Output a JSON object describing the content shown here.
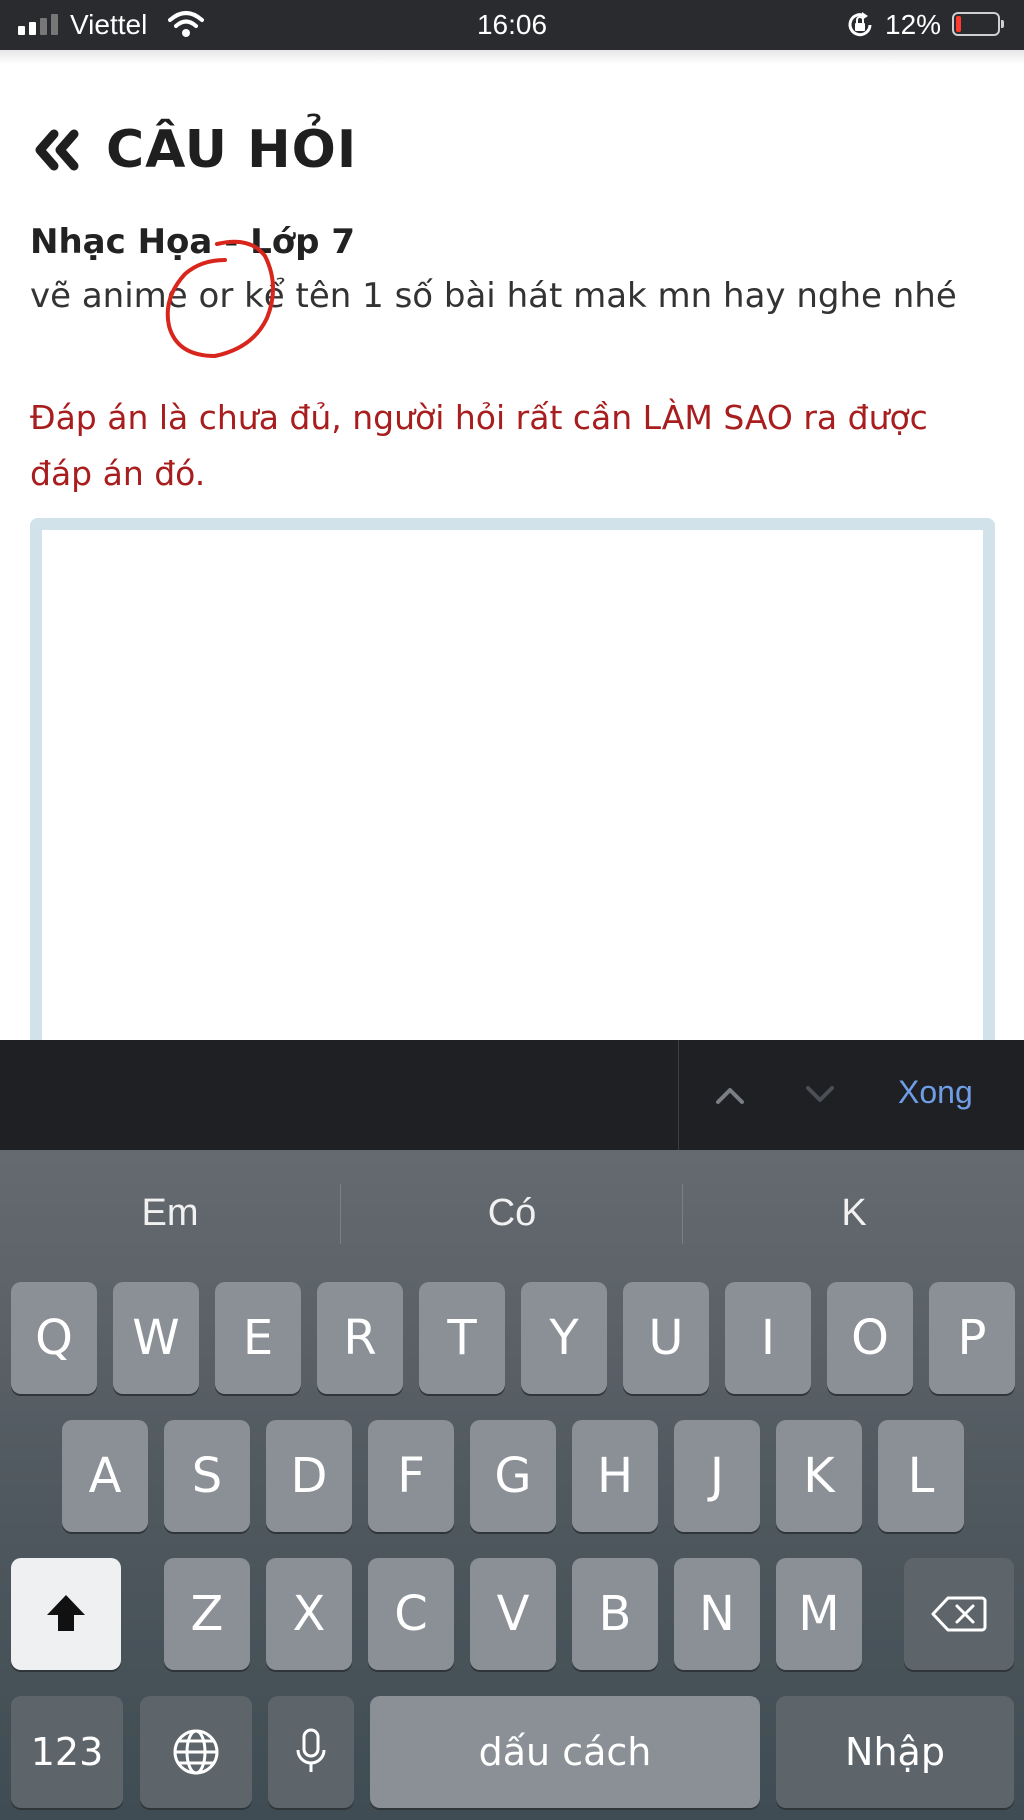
{
  "status_bar": {
    "carrier": "Viettel",
    "time": "16:06",
    "battery_percent": "12%",
    "battery_level": 0.12,
    "icons": [
      "signal-icon",
      "wifi-icon",
      "orientation-lock-icon",
      "battery-icon"
    ]
  },
  "header": {
    "back_icon": "double-chevron-left-icon",
    "title": "CÂU HỎI"
  },
  "question": {
    "subject": "Nhạc Họa - Lớp 7",
    "text": "vẽ anime or kể tên 1 số bài hát mak mn hay nghe nhé",
    "annotation_color": "#d9261c"
  },
  "warning": {
    "text": "Đáp án là chưa đủ, người hỏi rất cần LÀM SAO ra được đáp án đó.",
    "color": "#a81d1d"
  },
  "answer_input": {
    "value": "",
    "border_color": "#d1e2ea"
  },
  "keyboard_toolbar": {
    "prev_icon": "chevron-up-icon",
    "next_icon": "chevron-down-icon",
    "done_label": "Xong"
  },
  "keyboard": {
    "suggestions": [
      "Em",
      "Có",
      "K"
    ],
    "row1": [
      "Q",
      "W",
      "E",
      "R",
      "T",
      "Y",
      "U",
      "I",
      "O",
      "P"
    ],
    "row2": [
      "A",
      "S",
      "D",
      "F",
      "G",
      "H",
      "J",
      "K",
      "L"
    ],
    "row3": [
      "Z",
      "X",
      "C",
      "V",
      "B",
      "N",
      "M"
    ],
    "numbers_label": "123",
    "space_label": "dấu cách",
    "return_label": "Nhập",
    "special_icons": [
      "shift-icon",
      "backspace-icon",
      "globe-icon",
      "microphone-icon"
    ]
  }
}
